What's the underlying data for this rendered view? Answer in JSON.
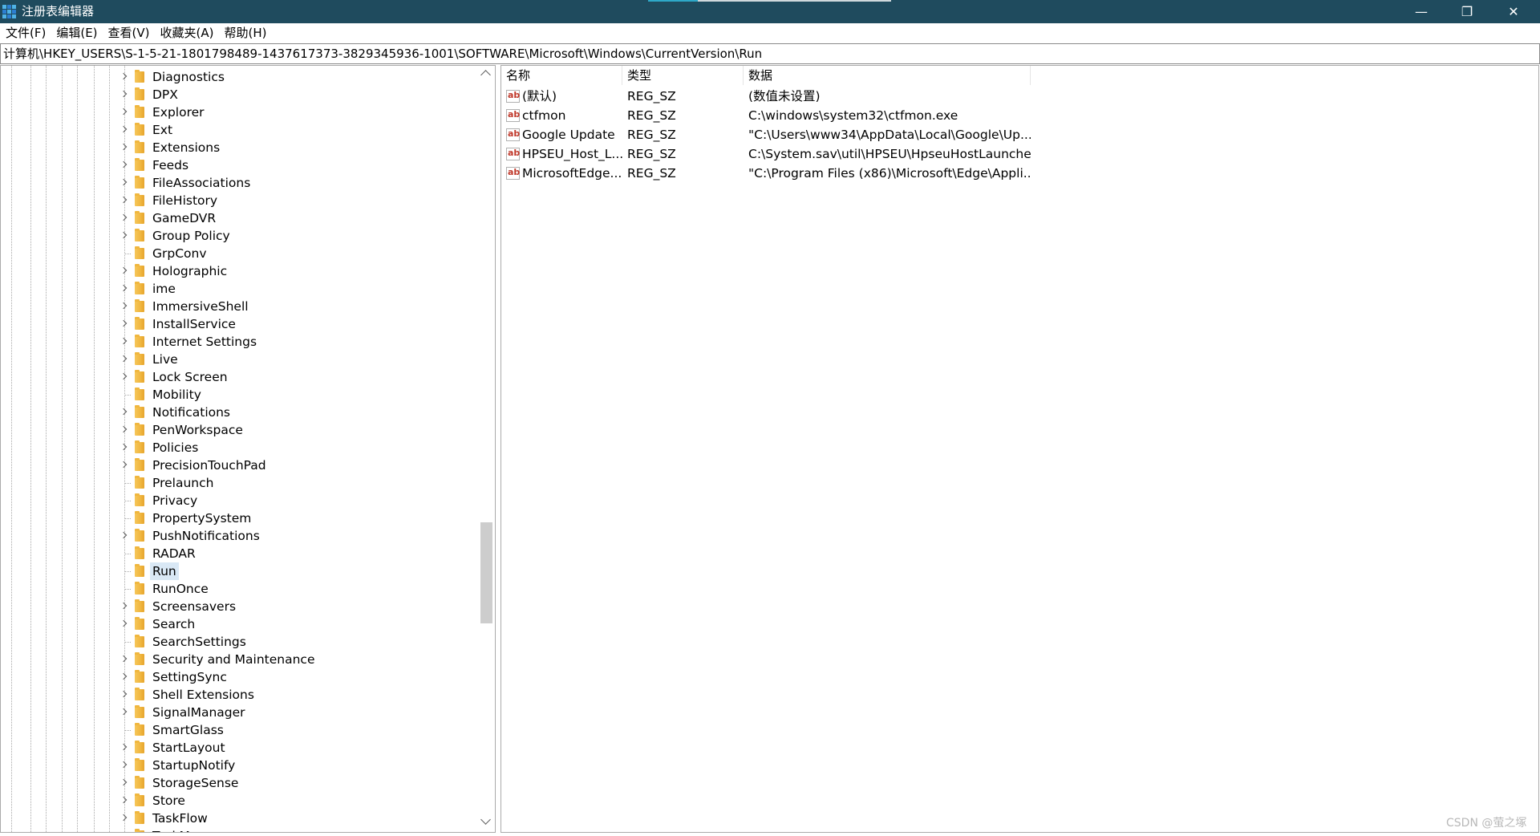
{
  "window": {
    "title": "注册表编辑器",
    "controls": {
      "minimize": "—",
      "maximize": "❐",
      "close": "✕"
    }
  },
  "menu": [
    "文件(F)",
    "编辑(E)",
    "查看(V)",
    "收藏夹(A)",
    "帮助(H)"
  ],
  "address": "计算机\\HKEY_USERS\\S-1-5-21-1801798489-1437617373-3829345936-1001\\SOFTWARE\\Microsoft\\Windows\\CurrentVersion\\Run",
  "tree": {
    "items": [
      {
        "label": "Diagnostics",
        "expandable": true
      },
      {
        "label": "DPX",
        "expandable": true
      },
      {
        "label": "Explorer",
        "expandable": true
      },
      {
        "label": "Ext",
        "expandable": true
      },
      {
        "label": "Extensions",
        "expandable": true
      },
      {
        "label": "Feeds",
        "expandable": true
      },
      {
        "label": "FileAssociations",
        "expandable": true
      },
      {
        "label": "FileHistory",
        "expandable": true
      },
      {
        "label": "GameDVR",
        "expandable": true
      },
      {
        "label": "Group Policy",
        "expandable": true
      },
      {
        "label": "GrpConv",
        "expandable": false
      },
      {
        "label": "Holographic",
        "expandable": true
      },
      {
        "label": "ime",
        "expandable": true
      },
      {
        "label": "ImmersiveShell",
        "expandable": true
      },
      {
        "label": "InstallService",
        "expandable": true
      },
      {
        "label": "Internet Settings",
        "expandable": true
      },
      {
        "label": "Live",
        "expandable": true
      },
      {
        "label": "Lock Screen",
        "expandable": true
      },
      {
        "label": "Mobility",
        "expandable": false
      },
      {
        "label": "Notifications",
        "expandable": true
      },
      {
        "label": "PenWorkspace",
        "expandable": true
      },
      {
        "label": "Policies",
        "expandable": true
      },
      {
        "label": "PrecisionTouchPad",
        "expandable": true
      },
      {
        "label": "Prelaunch",
        "expandable": false
      },
      {
        "label": "Privacy",
        "expandable": false
      },
      {
        "label": "PropertySystem",
        "expandable": false
      },
      {
        "label": "PushNotifications",
        "expandable": true
      },
      {
        "label": "RADAR",
        "expandable": false
      },
      {
        "label": "Run",
        "expandable": false,
        "selected": true
      },
      {
        "label": "RunOnce",
        "expandable": false
      },
      {
        "label": "Screensavers",
        "expandable": true
      },
      {
        "label": "Search",
        "expandable": true
      },
      {
        "label": "SearchSettings",
        "expandable": false
      },
      {
        "label": "Security and Maintenance",
        "expandable": true
      },
      {
        "label": "SettingSync",
        "expandable": true
      },
      {
        "label": "Shell Extensions",
        "expandable": true
      },
      {
        "label": "SignalManager",
        "expandable": true
      },
      {
        "label": "SmartGlass",
        "expandable": false
      },
      {
        "label": "StartLayout",
        "expandable": true
      },
      {
        "label": "StartupNotify",
        "expandable": true
      },
      {
        "label": "StorageSense",
        "expandable": true
      },
      {
        "label": "Store",
        "expandable": true
      },
      {
        "label": "TaskFlow",
        "expandable": true
      },
      {
        "label": "TaskManager",
        "expandable": false
      }
    ]
  },
  "values": {
    "columns": {
      "name": "名称",
      "type": "类型",
      "data": "数据"
    },
    "rows": [
      {
        "name": "(默认)",
        "type": "REG_SZ",
        "data": "(数值未设置)"
      },
      {
        "name": "ctfmon",
        "type": "REG_SZ",
        "data": "C:\\windows\\system32\\ctfmon.exe"
      },
      {
        "name": "Google Update",
        "type": "REG_SZ",
        "data": "\"C:\\Users\\www34\\AppData\\Local\\Google\\Up..."
      },
      {
        "name": "HPSEU_Host_L...",
        "type": "REG_SZ",
        "data": "C:\\System.sav\\util\\HPSEU\\HpseuHostLaunche..."
      },
      {
        "name": "MicrosoftEdge...",
        "type": "REG_SZ",
        "data": "\"C:\\Program Files (x86)\\Microsoft\\Edge\\Appli..."
      }
    ]
  },
  "watermark": "CSDN @萤之塚",
  "colors": {
    "titlebar": "#1f4b5e",
    "selection": "#d9e8f5",
    "folder": "#f0b73f",
    "string_icon": "#c0392b"
  },
  "icons": {
    "app": "registry-editor-icon",
    "folder": "folder-icon",
    "expander": "chevron-right-icon",
    "value": "string-value-icon"
  }
}
